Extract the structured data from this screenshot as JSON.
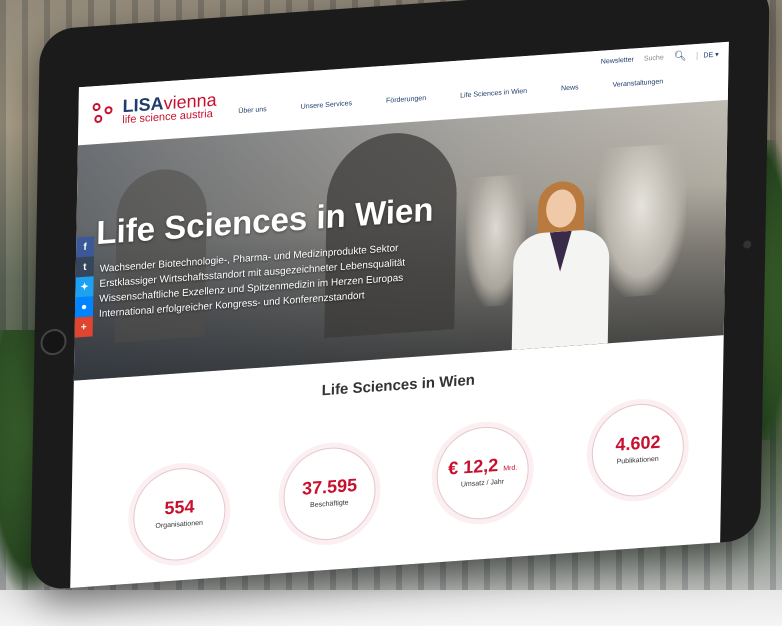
{
  "header": {
    "logo_main": "LISA",
    "logo_accent": "vienna",
    "logo_sub": "life science austria",
    "util_links": {
      "newsletter": "Newsletter",
      "search": "Suche",
      "lang": "DE"
    },
    "nav": [
      "Über uns",
      "Unsere Services",
      "Förderungen",
      "Life Sciences in Wien",
      "News",
      "Veranstaltungen"
    ]
  },
  "hero": {
    "title": "Life Sciences in Wien",
    "bullets": [
      "Wachsender Biotechnologie-, Pharma- und Medizinprodukte Sektor",
      "Erstklassiger Wirtschaftsstandort mit ausgezeichneter Lebensqualität",
      "Wissenschaftliche Exzellenz und Spitzenmedizin im Herzen Europas",
      "International erfolgreicher Kongress- und Konferenzstandort"
    ],
    "social": [
      "f",
      "t",
      "tw",
      "m",
      "+"
    ]
  },
  "stats": {
    "title": "Life Sciences in Wien",
    "items": [
      {
        "value": "554",
        "unit": "",
        "label": "Organisationen"
      },
      {
        "value": "37.595",
        "unit": "",
        "label": "Beschäftigte"
      },
      {
        "value": "€ 12,2",
        "unit": "Mrd.",
        "label": "Umsatz / Jahr"
      },
      {
        "value": "4.602",
        "unit": "",
        "label": "Publikationen"
      }
    ]
  },
  "colors": {
    "brand_red": "#c8102e",
    "brand_blue": "#1e3d6b"
  }
}
